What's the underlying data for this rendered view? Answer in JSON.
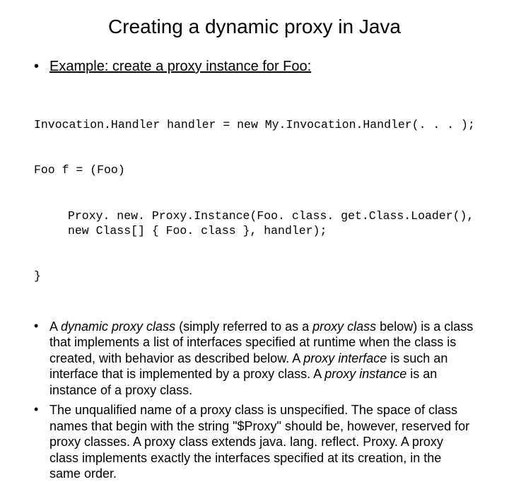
{
  "title": "Creating a dynamic proxy in Java",
  "example_label": "Example: create a proxy instance for  Foo:",
  "code": {
    "line1": "Invocation.Handler handler = new My.Invocation.Handler(. . . );",
    "line2": "Foo f = (Foo)",
    "line3": "Proxy. new. Proxy.Instance(Foo. class. get.Class.Loader(), new Class[] { Foo. class }, handler);",
    "line4": "}"
  },
  "para1": {
    "pre": "A ",
    "em1": "dynamic proxy class",
    "mid1": " (simply referred to as a ",
    "em2": "proxy class",
    "mid2": " below) is a class that implements a list of interfaces specified at runtime when the class is created, with behavior as described below. A ",
    "em3": "proxy interface",
    "mid3": " is such an interface that is implemented by a proxy class. A ",
    "em4": "proxy instance",
    "post": " is an instance of a proxy class."
  },
  "para2": "The unqualified name of a proxy class is unspecified. The space of class names that begin with the string \"$Proxy\" should be, however, reserved for proxy classes. A proxy class extends java. lang. reflect. Proxy. A proxy class implements exactly the interfaces specified at its creation, in the same order."
}
